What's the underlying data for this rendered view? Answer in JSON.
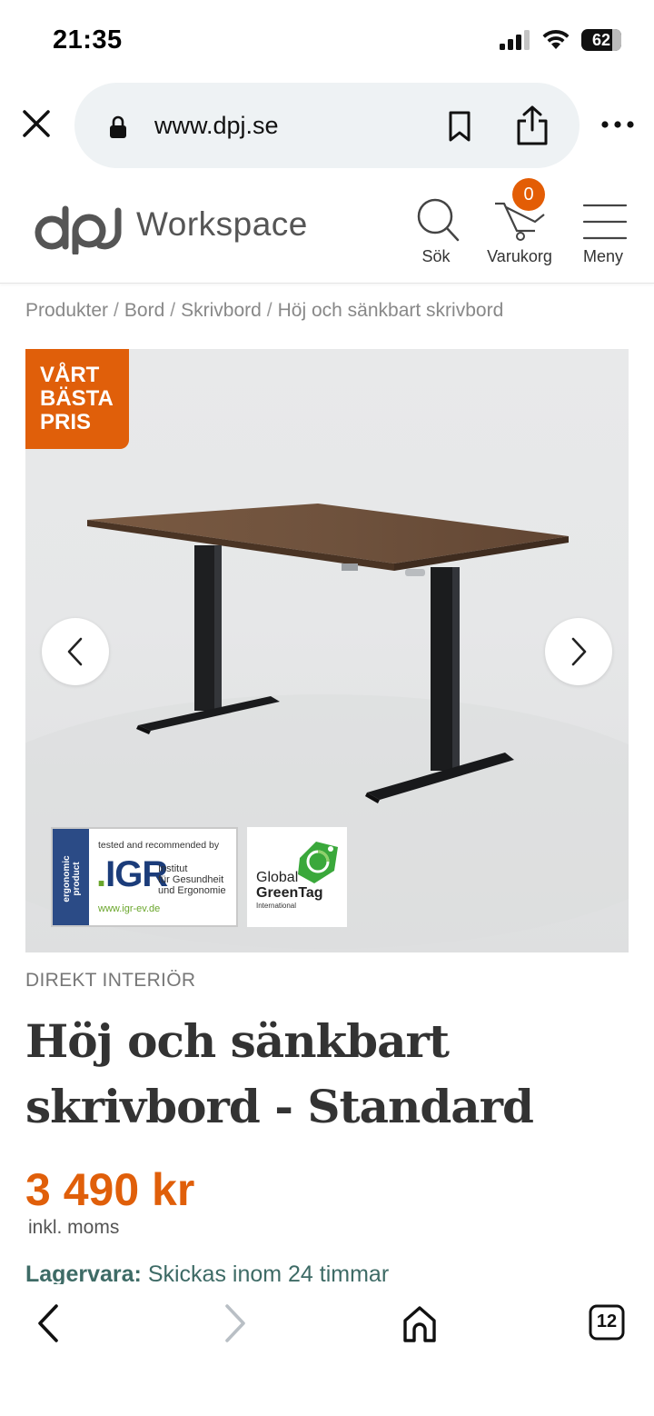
{
  "status_bar": {
    "time": "21:35",
    "battery": "62"
  },
  "browser": {
    "url": "www.dpj.se",
    "tab_count": "12"
  },
  "header": {
    "logo_text": "Workspace",
    "search_label": "Sök",
    "cart_label": "Varukorg",
    "cart_count": "0",
    "menu_label": "Meny"
  },
  "breadcrumb": [
    "Produkter",
    "Bord",
    "Skrivbord",
    "Höj och sänkbart skrivbord"
  ],
  "breadcrumb_sep": "/",
  "hero": {
    "badge": [
      "VÅRT",
      "BÄSTA",
      "PRIS"
    ],
    "igr": {
      "side_text": "ergonomic product",
      "tested": "tested and recommended by",
      "logo": "IGR",
      "institute": [
        "Institut",
        "für Gesundheit",
        "und Ergonomie"
      ],
      "url": "www.igr-ev.de"
    },
    "greentag": {
      "line1": "Global",
      "line2": "GreenTag",
      "line3": "International"
    }
  },
  "product": {
    "brand": "DIREKT INTERIÖR",
    "title": "Höj och sänkbart skrivbord - Standard",
    "price": "3 490 kr",
    "vat": "inkl. moms",
    "stock_label": "Lagervara:",
    "stock_text": "Skickas inom 24 timmar"
  },
  "colors": {
    "accent": "#e05f0a",
    "stock": "#3e6b66",
    "igr_blue": "#2b4b86"
  },
  "icons": [
    "close-icon",
    "lock-icon",
    "bookmark-icon",
    "share-icon",
    "more-icon",
    "search-icon",
    "cart-icon",
    "menu-icon",
    "chevron-left-icon",
    "chevron-right-icon",
    "home-icon",
    "tabs-icon"
  ]
}
